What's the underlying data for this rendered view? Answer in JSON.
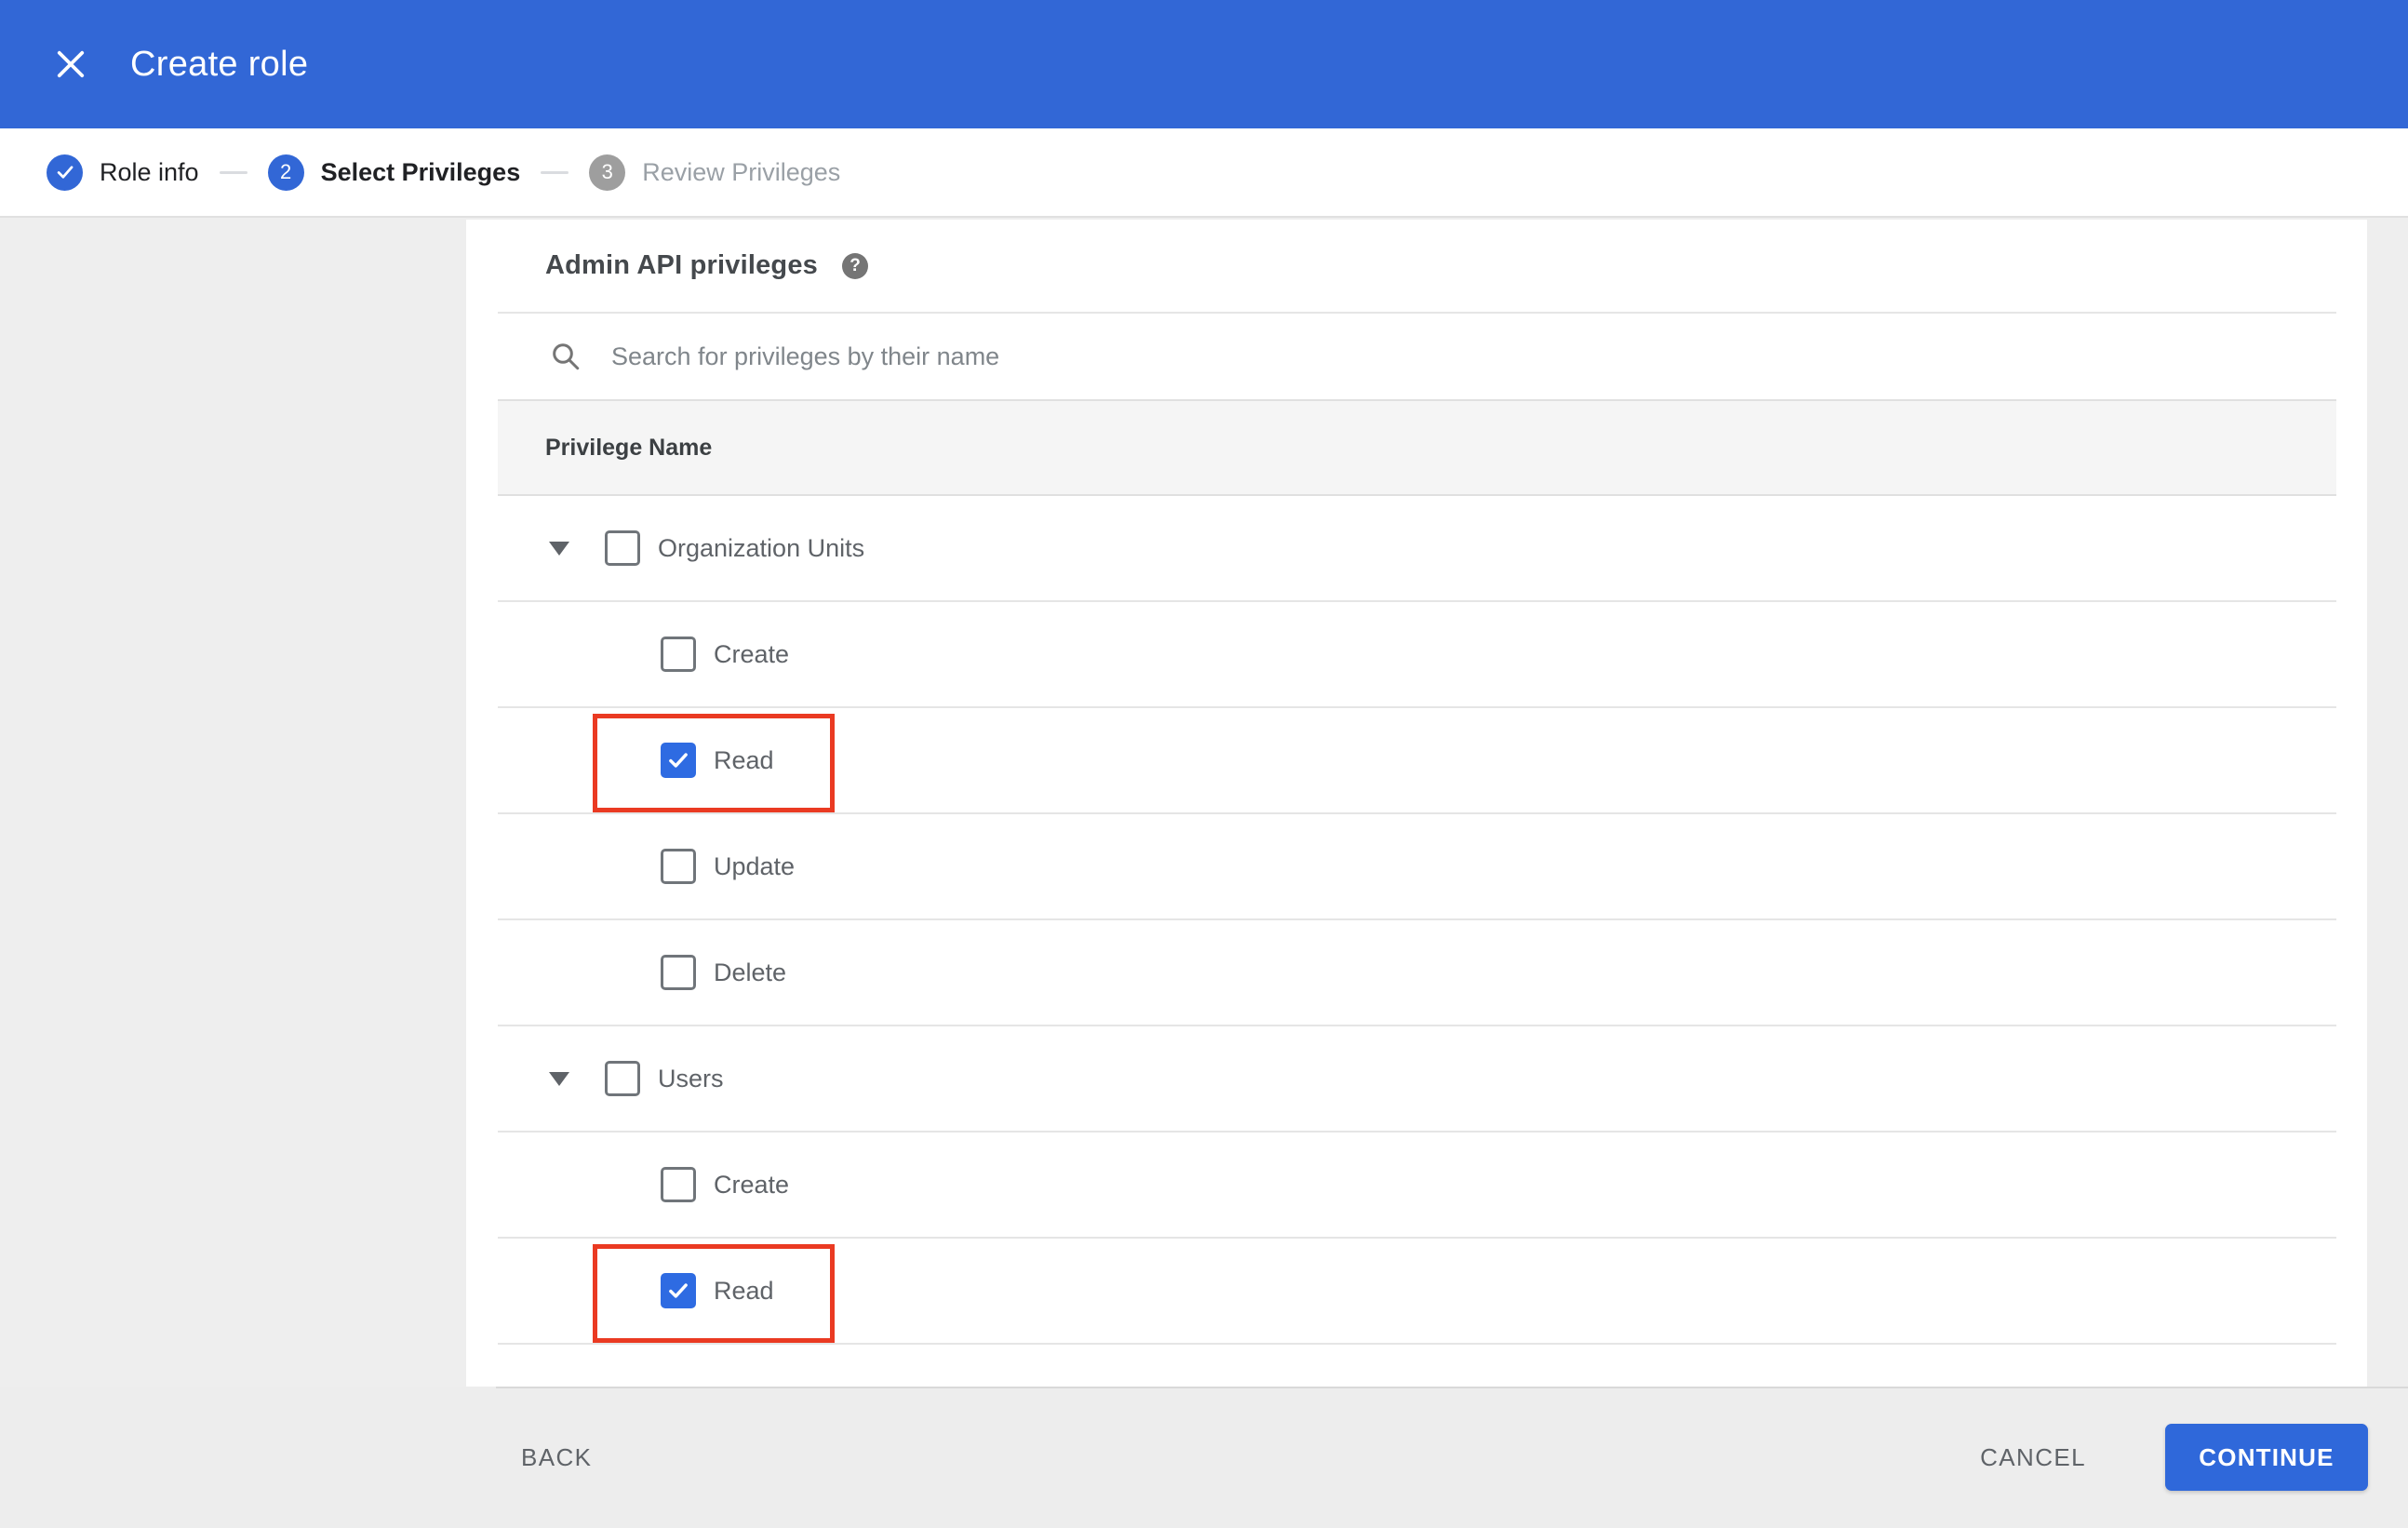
{
  "colors": {
    "appbar_blue": "#3267d6",
    "checkbox_blue": "#2e6be2",
    "continue_blue": "#2f68da",
    "annotation_red": "#ea3a22",
    "inactive_step_gray": "#9e9e9e",
    "table_header_bg": "#f5f5f5",
    "footer_bg": "#ededed"
  },
  "appbar": {
    "title": "Create role",
    "close_icon": "x-close"
  },
  "stepper": {
    "steps": [
      {
        "number": "1",
        "label": "Role info",
        "state": "complete",
        "icon": "checkmark"
      },
      {
        "number": "2",
        "label": "Select Privileges",
        "state": "active"
      },
      {
        "number": "3",
        "label": "Review Privileges",
        "state": "inactive"
      }
    ]
  },
  "panel": {
    "heading": "Admin API privileges",
    "help_glyph": "?",
    "search": {
      "placeholder": "Search for privileges by their name",
      "value": "",
      "icon": "magnifier"
    },
    "column_header": "Privilege Name",
    "rows": [
      {
        "label": "Organization Units",
        "level": 0,
        "expanded": true,
        "checked": false,
        "highlighted": false
      },
      {
        "label": "Create",
        "level": 1,
        "checked": false,
        "highlighted": false
      },
      {
        "label": "Read",
        "level": 1,
        "checked": true,
        "highlighted": true
      },
      {
        "label": "Update",
        "level": 1,
        "checked": false,
        "highlighted": false
      },
      {
        "label": "Delete",
        "level": 1,
        "checked": false,
        "highlighted": false
      },
      {
        "label": "Users",
        "level": 0,
        "expanded": true,
        "checked": false,
        "highlighted": false
      },
      {
        "label": "Create",
        "level": 1,
        "checked": false,
        "highlighted": false
      },
      {
        "label": "Read",
        "level": 1,
        "checked": true,
        "highlighted": true
      }
    ]
  },
  "footer": {
    "back_label": "BACK",
    "cancel_label": "CANCEL",
    "continue_label": "CONTINUE"
  }
}
